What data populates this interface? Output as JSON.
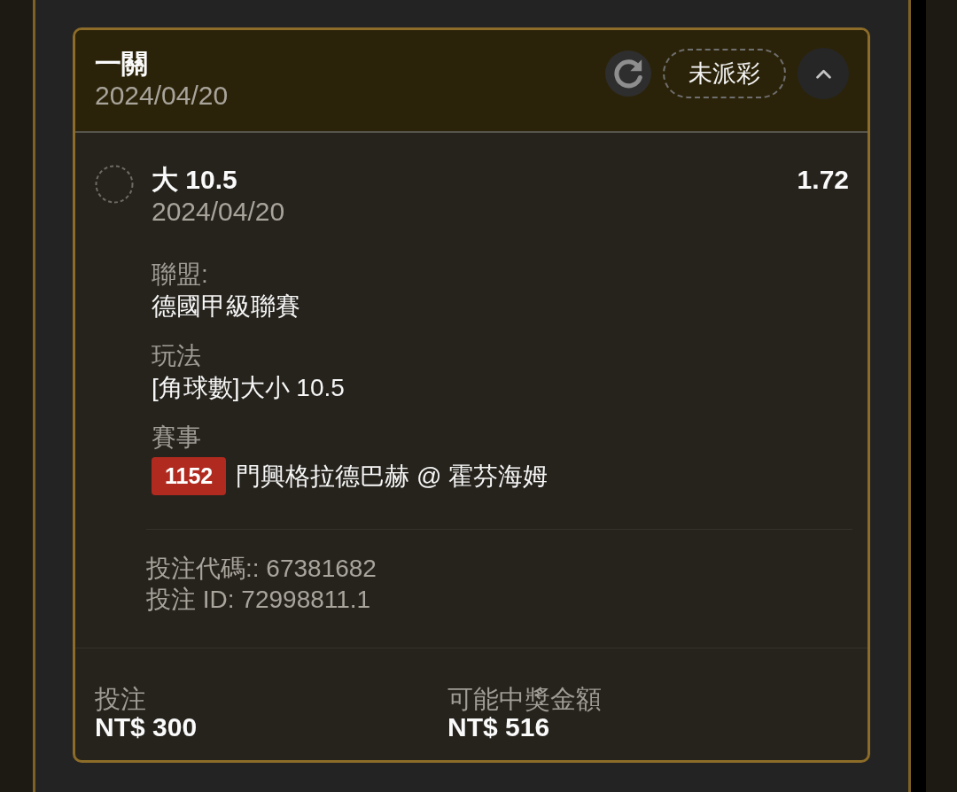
{
  "bet_card": {
    "title": "一關",
    "date": "2024/04/20",
    "status": "未派彩",
    "expanded": true,
    "selections": [
      {
        "name": "大 10.5",
        "date": "2024/04/20",
        "odds": "1.72",
        "details": [
          {
            "label": "聯盟:",
            "value": "德國甲級聯賽"
          },
          {
            "label": "玩法",
            "value": "[角球數]大小 10.5"
          },
          {
            "label": "賽事",
            "match_code": "1152",
            "value": "門興格拉德巴赫 @ 霍芬海姆"
          }
        ],
        "bet_code": "投注代碼:: 67381682",
        "bet_id": "投注 ID: 72998811.1"
      }
    ],
    "summary": [
      {
        "label": "投注",
        "value": "NT$ 300"
      },
      {
        "label": "可能中獎金額",
        "value": "NT$ 516"
      }
    ]
  }
}
